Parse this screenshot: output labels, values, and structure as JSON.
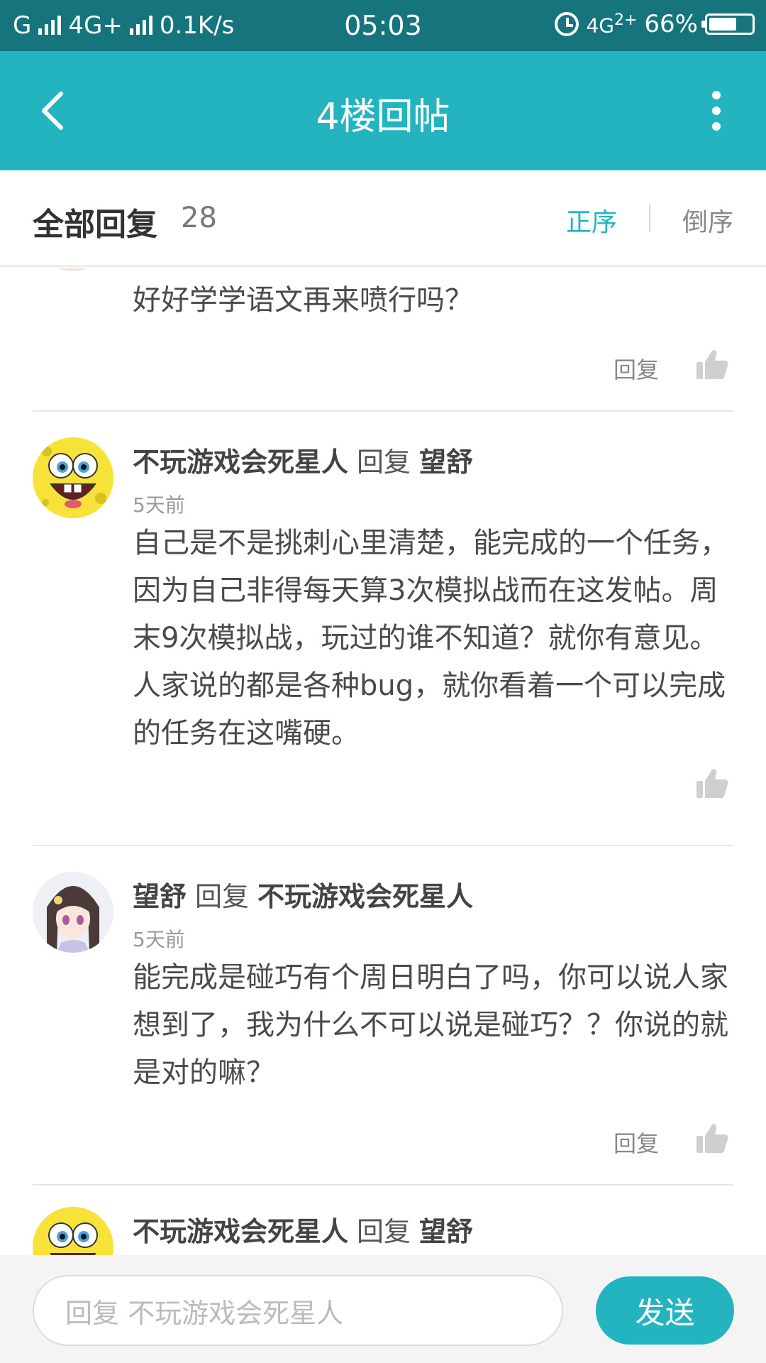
{
  "status_bar": {
    "carrier_left": "G",
    "network_left": "4G+",
    "speed": "0.1K/s",
    "time": "05:03",
    "network_right": "4G",
    "network_right_sup": "2+",
    "battery": "66%",
    "battery_level": 0.66
  },
  "title_bar": {
    "title": "4楼回帖",
    "icons": {
      "back": "back-chevron-icon",
      "more": "more-vertical-icon"
    },
    "color": "#23b4c0"
  },
  "list_header": {
    "title": "全部回复",
    "count": "28",
    "sort_asc": "正序",
    "sort_desc": "倒序",
    "active_color": "#23b4c0"
  },
  "comments": [
    {
      "body": "好好学学语文再来喷行吗？",
      "reply_label": "回复"
    },
    {
      "author": "不玩游戏会死星人",
      "verb": "回复",
      "target": "望舒",
      "time": "5天前",
      "avatar": "spongebob-avatar",
      "body": "自己是不是挑刺心里清楚，能完成的一个任务，因为自己非得每天算3次模拟战而在这发帖。周末9次模拟战，玩过的谁不知道？就你有意见。人家说的都是各种bug，就你看着一个可以完成的任务在这嘴硬。"
    },
    {
      "author": "望舒",
      "verb": "回复",
      "target": "不玩游戏会死星人",
      "time": "5天前",
      "avatar": "anime-girl-avatar",
      "body": "能完成是碰巧有个周日明白了吗，你可以说人家想到了，我为什么不可以说是碰巧？？你说的就是对的嘛？",
      "reply_label": "回复"
    },
    {
      "author": "不玩游戏会死星人",
      "verb": "回复",
      "target": "望舒",
      "avatar": "spongebob-avatar"
    }
  ],
  "input_bar": {
    "placeholder": "回复 不玩游戏会死星人",
    "send_label": "发送"
  }
}
